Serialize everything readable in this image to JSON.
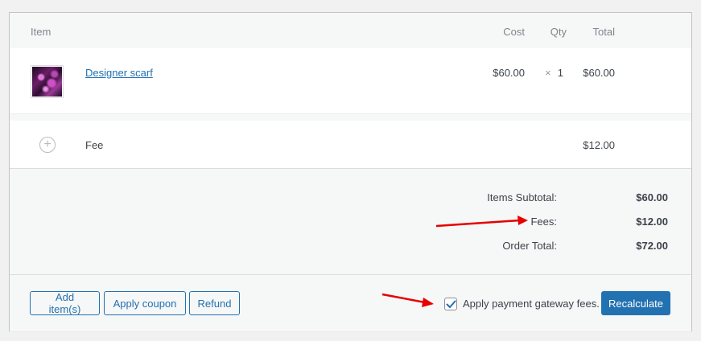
{
  "header": {
    "item": "Item",
    "cost": "Cost",
    "qty": "Qty",
    "total": "Total"
  },
  "items": [
    {
      "name": "Designer scarf",
      "cost": "$60.00",
      "qty_times": "×",
      "qty": "1",
      "total": "$60.00",
      "thumbnail_icon": "scarf-thumbnail"
    }
  ],
  "fees": [
    {
      "label": "Fee",
      "total": "$12.00",
      "icon": "plus-circle-icon"
    }
  ],
  "totals": {
    "items_subtotal_label": "Items Subtotal:",
    "items_subtotal": "$60.00",
    "fees_label": "Fees:",
    "fees": "$12.00",
    "order_total_label": "Order Total:",
    "order_total": "$72.00"
  },
  "actions": {
    "add_items": "Add item(s)",
    "apply_coupon": "Apply coupon",
    "refund": "Refund",
    "gateway_fees_label": "Apply payment gateway fees.",
    "gateway_fees_checked": true,
    "recalculate": "Recalculate"
  },
  "colors": {
    "accent": "#2271b1",
    "annotation_arrow": "#e60000"
  }
}
